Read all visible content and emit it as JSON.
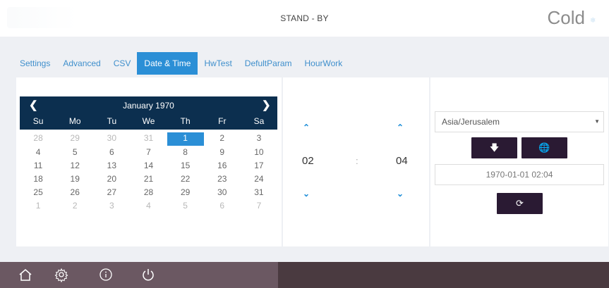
{
  "header": {
    "status": "STAND - BY",
    "mode": "Cold",
    "mode_icon": "snowflake-icon"
  },
  "tabs": [
    {
      "label": "Settings",
      "active": false
    },
    {
      "label": "Advanced",
      "active": false
    },
    {
      "label": "CSV",
      "active": false
    },
    {
      "label": "Date & Time",
      "active": true
    },
    {
      "label": "HwTest",
      "active": false
    },
    {
      "label": "DefultParam",
      "active": false
    },
    {
      "label": "HourWork",
      "active": false
    }
  ],
  "calendar": {
    "month_label": "January 1970",
    "prev_icon": "chevron-left-icon",
    "next_icon": "chevron-right-icon",
    "weekdays": [
      "Su",
      "Mo",
      "Tu",
      "We",
      "Th",
      "Fr",
      "Sa"
    ],
    "weeks": [
      [
        "28",
        "29",
        "30",
        "31",
        "1",
        "2",
        "3"
      ],
      [
        "4",
        "5",
        "6",
        "7",
        "8",
        "9",
        "10"
      ],
      [
        "11",
        "12",
        "13",
        "14",
        "15",
        "16",
        "17"
      ],
      [
        "18",
        "19",
        "20",
        "21",
        "22",
        "23",
        "24"
      ],
      [
        "25",
        "26",
        "27",
        "28",
        "29",
        "30",
        "31"
      ],
      [
        "1",
        "2",
        "3",
        "4",
        "5",
        "6",
        "7"
      ]
    ],
    "selected_day": "1"
  },
  "time": {
    "hour": "02",
    "separator": ":",
    "minute": "04"
  },
  "timezone": {
    "selected": "Asia/Jerusalem",
    "datetime_display": "1970-01-01 02:04"
  },
  "colors": {
    "accent": "#2b8fd6",
    "calendar_header": "#0c2f4f",
    "action_button": "#2a1a33",
    "bottom_bar": "#6b5862"
  },
  "bottom_nav": {
    "icons": [
      "home-icon",
      "settings-gear-icon",
      "info-icon",
      "power-icon"
    ]
  }
}
